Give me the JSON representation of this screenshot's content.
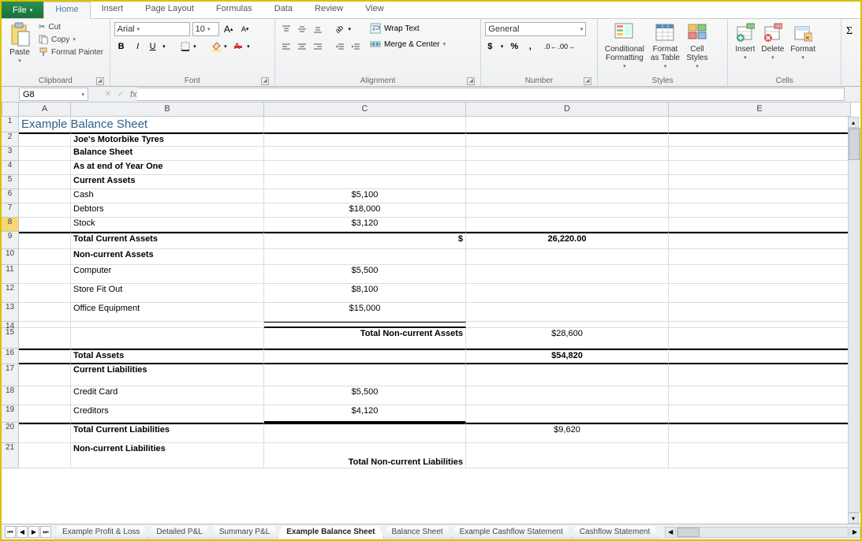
{
  "tabs": {
    "file": "File",
    "list": [
      "Home",
      "Insert",
      "Page Layout",
      "Formulas",
      "Data",
      "Review",
      "View"
    ],
    "active": "Home"
  },
  "ribbon": {
    "clipboard": {
      "label": "Clipboard",
      "paste": "Paste",
      "cut": "Cut",
      "copy": "Copy",
      "fmt": "Format Painter"
    },
    "font": {
      "label": "Font",
      "name": "Arial",
      "size": "10"
    },
    "alignment": {
      "label": "Alignment",
      "wrap": "Wrap Text",
      "merge": "Merge & Center"
    },
    "number": {
      "label": "Number",
      "format": "General"
    },
    "styles": {
      "label": "Styles",
      "cond": "Conditional\nFormatting",
      "table": "Format\nas Table",
      "cell": "Cell\nStyles"
    },
    "cells": {
      "label": "Cells",
      "insert": "Insert",
      "delete": "Delete",
      "format": "Format"
    }
  },
  "namebox": "G8",
  "fx_label": "fx",
  "columns": [
    "A",
    "B",
    "C",
    "D",
    "E"
  ],
  "rows": [
    "1",
    "2",
    "3",
    "4",
    "5",
    "6",
    "7",
    "8",
    "9",
    "10",
    "11",
    "12",
    "13",
    "14",
    "15",
    "16",
    "17",
    "18",
    "19",
    "20",
    "21"
  ],
  "cells": {
    "title": "Example Balance Sheet",
    "b2": "Joe's Motorbike Tyres",
    "b3": "Balance Sheet",
    "b4": "As at end of Year One",
    "b5": "Current Assets",
    "b6": "Cash",
    "c6": "$5,100",
    "b7": "Debtors",
    "c7": "$18,000",
    "b8": "Stock",
    "c8": "$3,120",
    "b9": "Total Current Assets",
    "c9_sym": "$",
    "d9": "26,220.00",
    "b10": "Non-current Assets",
    "b11": "Computer",
    "c11": "$5,500",
    "b12": "Store Fit Out",
    "c12": "$8,100",
    "b13": "Office Equipment",
    "c13": "$15,000",
    "c15": "Total Non-current Assets",
    "d15": "$28,600",
    "b16": "Total Assets",
    "d16": "$54,820",
    "b17": "Current Liabilities",
    "b18": "Credit Card",
    "c18": "$5,500",
    "b19": "Creditors",
    "c19": "$4,120",
    "b20": "Total Current Liabilities",
    "d20": "$9,620",
    "b21": "Non-current Liabilities",
    "c_last": "Total Non-current Liabilities"
  },
  "sheet_tabs": [
    "Example Profit & Loss",
    "Detailed P&L",
    "Summary P&L",
    "Example Balance Sheet",
    "Balance Sheet",
    "Example Cashflow Statement",
    "Cashflow Statement"
  ],
  "active_sheet": "Example Balance Sheet"
}
